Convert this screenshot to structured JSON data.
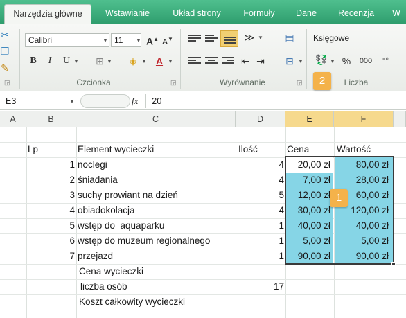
{
  "ribbon_tabs": [
    {
      "label": "Narzędzia główne",
      "active": true
    },
    {
      "label": "Wstawianie",
      "active": false
    },
    {
      "label": "Układ strony",
      "active": false
    },
    {
      "label": "Formuły",
      "active": false
    },
    {
      "label": "Dane",
      "active": false
    },
    {
      "label": "Recenzja",
      "active": false
    },
    {
      "label": "W",
      "active": false
    }
  ],
  "font_group": {
    "font_name": "Calibri",
    "font_size": "11",
    "label": "Czcionka",
    "grow_label": "A",
    "shrink_label": "A",
    "bold": "B",
    "italic": "I",
    "underline": "U",
    "font_color_label": "A"
  },
  "alignment_group": {
    "label": "Wyrównanie"
  },
  "number_group": {
    "format": "Księgowe",
    "label": "Liczba",
    "percent": "%",
    "thousands": "000",
    "badge": "2"
  },
  "formula_bar": {
    "cell_ref": "E3",
    "fx": "fx",
    "value": "20"
  },
  "columns": [
    "A",
    "B",
    "C",
    "D",
    "E",
    "F"
  ],
  "headers": {
    "lp": "Lp",
    "element": "Element wycieczki",
    "ilosc": "Ilość",
    "cena": "Cena",
    "wartosc": "Wartość"
  },
  "rows": [
    {
      "lp": "1",
      "element": "noclegi",
      "ilosc": "4",
      "cena": "20,00 zł",
      "wartosc": "80,00 zł"
    },
    {
      "lp": "2",
      "element": "śniadania",
      "ilosc": "4",
      "cena": "7,00 zł",
      "wartosc": "28,00 zł"
    },
    {
      "lp": "3",
      "element": "suchy prowiant na dzień",
      "ilosc": "5",
      "cena": "12,00 zł",
      "wartosc": "60,00 zł"
    },
    {
      "lp": "4",
      "element": "obiadokolacja",
      "ilosc": "4",
      "cena": "30,00 zł",
      "wartosc": "120,00 zł"
    },
    {
      "lp": "5",
      "element": "wstęp do  aquaparku",
      "ilosc": "1",
      "cena": "40,00 zł",
      "wartosc": "40,00 zł"
    },
    {
      "lp": "6",
      "element": "wstęp do muzeum regionalnego",
      "ilosc": "1",
      "cena": "5,00 zł",
      "wartosc": "5,00 zł"
    },
    {
      "lp": "7",
      "element": "przejazd",
      "ilosc": "1",
      "cena": "90,00 zł",
      "wartosc": "90,00 zł"
    }
  ],
  "summary": {
    "cena_label": "Cena wycieczki",
    "osoby_label": "liczba osób",
    "osoby_value": "17",
    "koszt_label": "Koszt całkowity wycieczki"
  },
  "selection_badge": "1",
  "colors": {
    "ribbon_green": "#2f9e6e",
    "selected_fill": "#86d5e6",
    "badge_orange": "#f4b24a",
    "selected_header": "#f6d98d"
  }
}
